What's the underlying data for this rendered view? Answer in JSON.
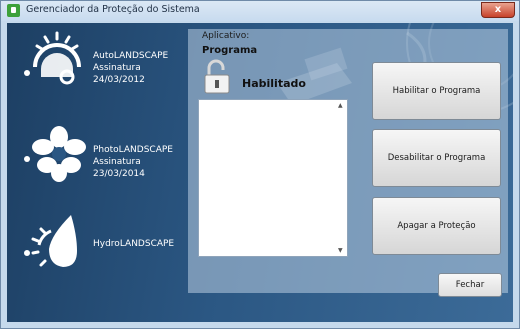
{
  "window": {
    "title": "Gerenciador da Proteção do Sistema",
    "close_glyph": "x"
  },
  "products": [
    {
      "name": "AutoLANDSCAPE",
      "signature": "Assinatura 24/03/2012",
      "icon": "gauge-icon"
    },
    {
      "name": "PhotoLANDSCAPE",
      "signature": "Assinatura 23/03/2014",
      "icon": "flower-icon"
    },
    {
      "name": "HydroLANDSCAPE",
      "signature": "",
      "icon": "water-drop-icon"
    }
  ],
  "details": {
    "app_label": "Aplicativo:",
    "program_label": "Programa",
    "status": "Habilitado",
    "status_icon": "unlocked-padlock-icon"
  },
  "buttons": {
    "enable": "Habilitar o Programa",
    "disable": "Desabilitar o Programa",
    "erase": "Apagar a Proteção",
    "close": "Fechar"
  },
  "colors": {
    "background": "#2b5783",
    "panel": "#b9cde1"
  }
}
